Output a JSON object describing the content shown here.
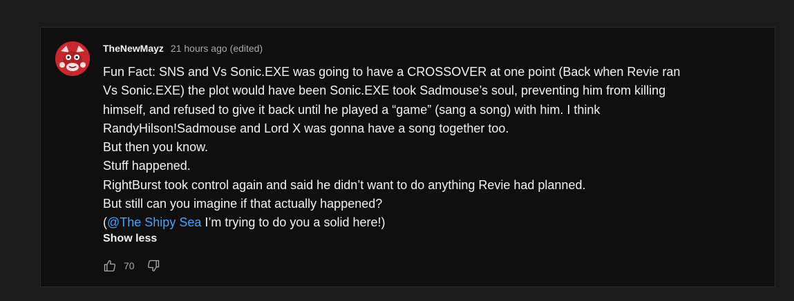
{
  "comment": {
    "author": "TheNewMayz",
    "timestamp": "21 hours ago",
    "edited": "(edited)",
    "lines": [
      "Fun Fact: SNS and Vs Sonic.EXE was going to have a CROSSOVER at one point (Back when Revie ran",
      "Vs Sonic.EXE) the plot would have been Sonic.EXE took Sadmouse’s soul, preventing him from killing",
      "himself, and refused to give it back until he played a “game” (sang a song) with him. I think",
      "RandyHilson!Sadmouse and Lord X was gonna have a song together too.",
      "But then you know.",
      "Stuff happened.",
      "RightBurst took control again and said he didn’t want to do anything Revie had planned.",
      "But still can you imagine if that actually happened?"
    ],
    "last_line": {
      "open": "(",
      "mention": "@The Shipy Sea",
      "rest": " I’m trying to do you a solid here!)"
    },
    "show_less_label": "Show less",
    "like_count": "70"
  },
  "icons": {
    "like": "thumbs-up-icon",
    "dislike": "thumbs-down-icon",
    "avatar": "avatar-image"
  },
  "colors": {
    "background": "#1a1a1a",
    "card": "#0f0f0f",
    "text": "#f1f1f1",
    "secondary_text": "#aaaaaa",
    "mention": "#3ea6ff",
    "avatar_bg": "#c8272b"
  }
}
